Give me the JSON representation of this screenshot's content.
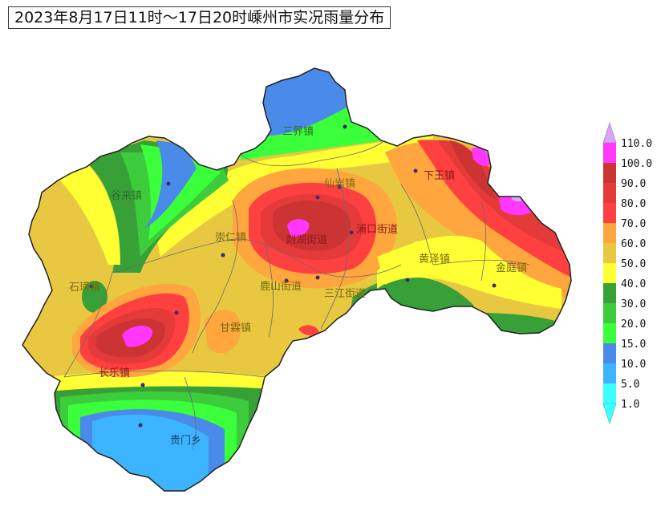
{
  "title": "2023年8月17日11时～17日20时嵊州市实况雨量分布",
  "towns": {
    "sanjie": "三界镇",
    "gulai": "谷来镇",
    "xianyan": "仙岩镇",
    "xiawang": "下王镇",
    "chongren": "崇仁镇",
    "pukou": "浦口街道",
    "yanhu": "剡湖街道",
    "huangze": "黄泽镇",
    "shihuang": "石璜镇",
    "lushan": "鹿山街道",
    "sanjiang": "三江街道",
    "jinting": "金庭镇",
    "ganlin": "甘霖镇",
    "changle": "长乐镇",
    "guimen": "贵门乡"
  },
  "legend": {
    "levels": [
      "110.0",
      "100.0",
      "90.0",
      "80.0",
      "70.0",
      "60.0",
      "50.0",
      "40.0",
      "30.0",
      "20.0",
      "15.0",
      "10.0",
      "5.0",
      "1.0"
    ],
    "colors": [
      "#d4a6f5",
      "#ff37ff",
      "#cc3333",
      "#e53a3a",
      "#ff4040",
      "#ffa63e",
      "#e8c840",
      "#ffff33",
      "#37a037",
      "#3ccc3c",
      "#3cff3c",
      "#4a8ae8",
      "#3cb4ff",
      "#3cffff"
    ]
  }
}
